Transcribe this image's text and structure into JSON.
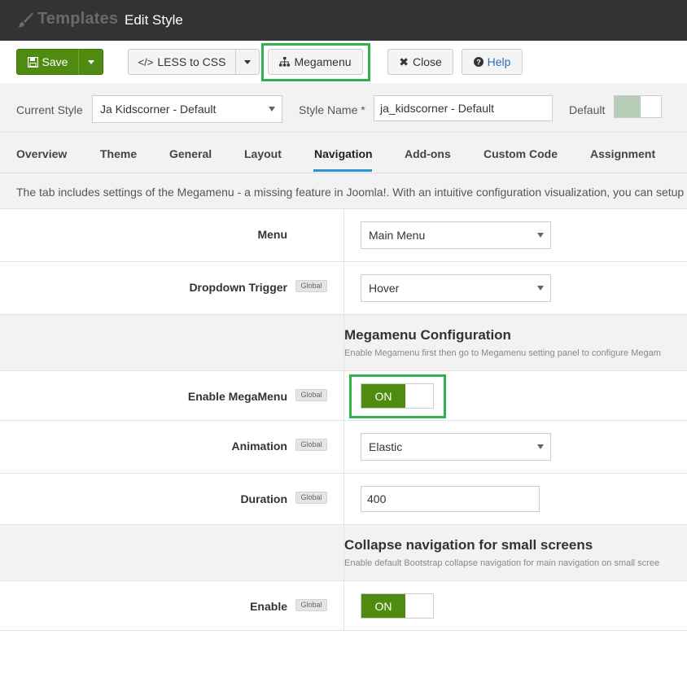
{
  "header": {
    "app_title": "Templates",
    "page_title": "Edit Style",
    "brand_icon": "paint-brush-icon"
  },
  "toolbar": {
    "save_label": "Save",
    "less_label": "LESS to CSS",
    "megamenu_label": "Megamenu",
    "close_label": "Close",
    "help_label": "Help"
  },
  "stylebar": {
    "current_style_label": "Current Style",
    "current_style_value": "Ja Kidscorner - Default",
    "style_name_label": "Style Name *",
    "style_name_value": "ja_kidscorner - Default",
    "default_label": "Default"
  },
  "tabs": [
    {
      "label": "Overview"
    },
    {
      "label": "Theme"
    },
    {
      "label": "General"
    },
    {
      "label": "Layout"
    },
    {
      "label": "Navigation",
      "active": true
    },
    {
      "label": "Add-ons"
    },
    {
      "label": "Custom Code"
    },
    {
      "label": "Assignment"
    }
  ],
  "intro_text": "The tab includes settings of the Megamenu - a missing feature in Joomla!. With an intuitive configuration visualization, you can setup",
  "fields": {
    "menu": {
      "label": "Menu",
      "value": "Main Menu"
    },
    "dropdown_trigger": {
      "label": "Dropdown Trigger",
      "badge": "Global",
      "value": "Hover"
    },
    "megamenu_section": {
      "title": "Megamenu Configuration",
      "desc": "Enable Megamenu first then go to Megamenu setting panel to configure Megam"
    },
    "enable_megamenu": {
      "label": "Enable MegaMenu",
      "badge": "Global",
      "value": "ON"
    },
    "animation": {
      "label": "Animation",
      "badge": "Global",
      "value": "Elastic"
    },
    "duration": {
      "label": "Duration",
      "badge": "Global",
      "value": "400"
    },
    "collapse_section": {
      "title": "Collapse navigation for small screens",
      "desc": "Enable default Bootstrap collapse navigation for main navigation on small scree"
    },
    "enable_collapse": {
      "label": "Enable",
      "badge": "Global",
      "value": "ON"
    }
  },
  "colors": {
    "accent_green": "#4e8b10",
    "highlight": "#2fb34a",
    "tab_underline": "#2f8fd0",
    "topbar": "#333333"
  }
}
